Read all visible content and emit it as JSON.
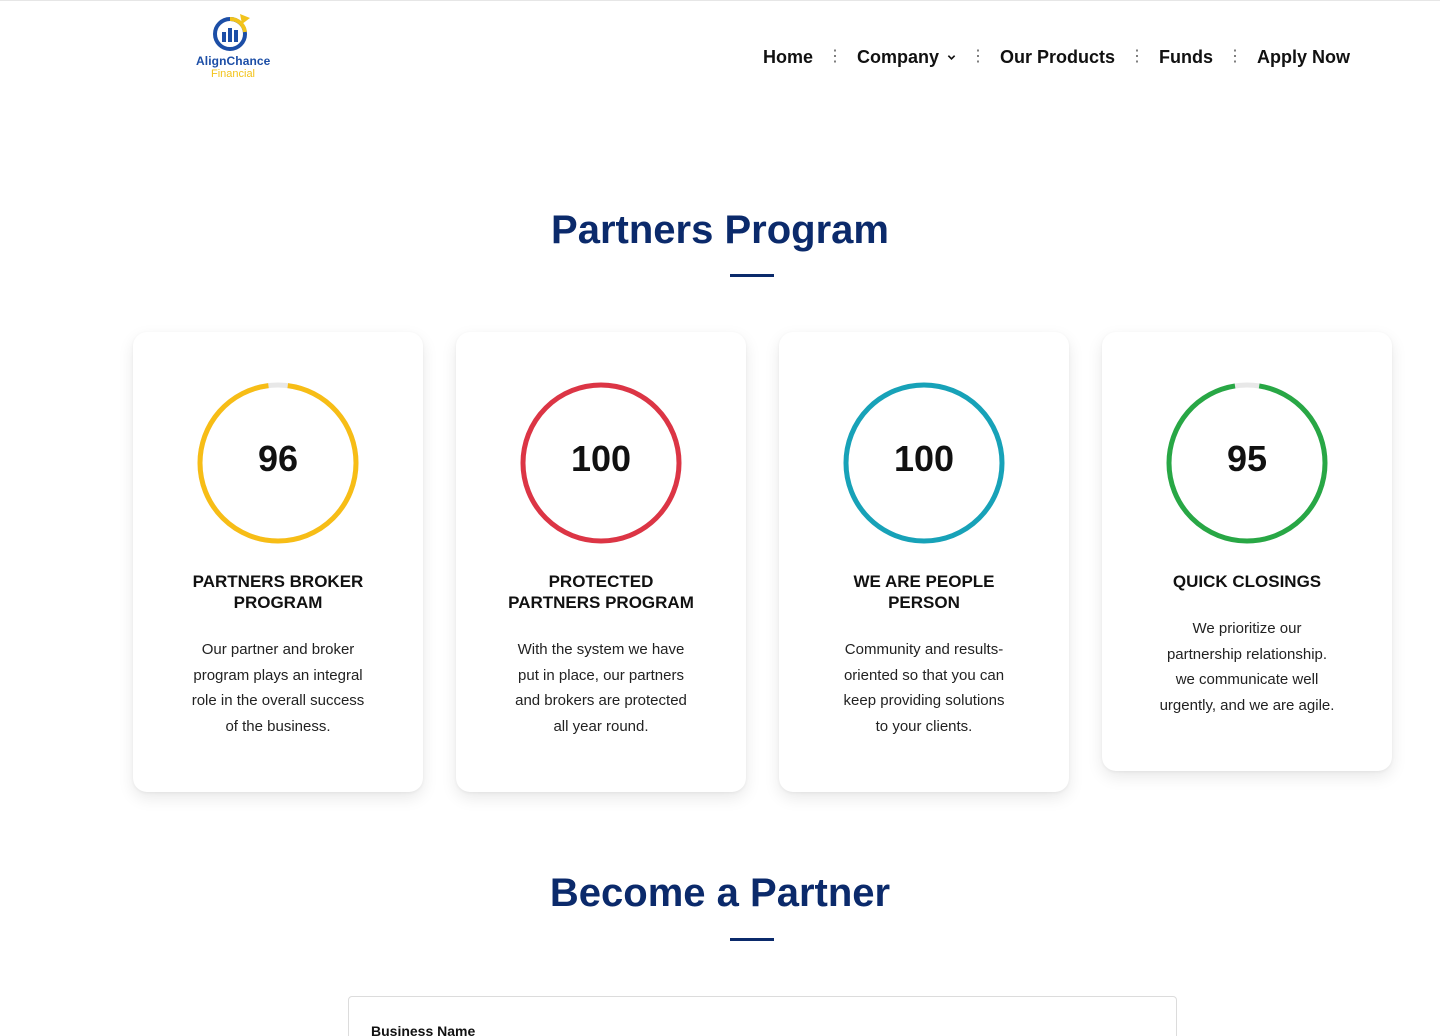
{
  "brand": {
    "name": "AlignChance",
    "sub": "Financial",
    "colors": {
      "blue": "#1c4ea6",
      "gold": "#f2c31b"
    }
  },
  "nav": {
    "items": [
      {
        "label": "Home"
      },
      {
        "label": "Company",
        "dropdown": true
      },
      {
        "label": "Our Products"
      },
      {
        "label": "Funds"
      },
      {
        "label": "Apply Now"
      }
    ]
  },
  "partners": {
    "title": "Partners Program",
    "cards": [
      {
        "value": "96",
        "percent": 96,
        "color": "#f7bd16",
        "title": "PARTNERS BROKER PROGRAM",
        "title_lines": [
          "PARTNERS BROKER",
          "PROGRAM"
        ],
        "text_lines": [
          "Our partner and broker",
          "program plays an integral",
          "role in the overall success",
          "of the business."
        ]
      },
      {
        "value": "100",
        "percent": 100,
        "color": "#dc3545",
        "title": "PROTECTED PARTNERS PROGRAM",
        "title_lines": [
          "PROTECTED",
          "PARTNERS PROGRAM"
        ],
        "text_lines": [
          "With the system we have",
          "put in place, our partners",
          "and brokers are protected",
          "all year round."
        ]
      },
      {
        "value": "100",
        "percent": 100,
        "color": "#17a2b8",
        "title": "WE ARE PEOPLE PERSON",
        "title_lines": [
          "WE ARE PEOPLE",
          "PERSON"
        ],
        "text_lines": [
          "Community and results-",
          "oriented so that you can",
          "keep providing solutions",
          "to your clients."
        ]
      },
      {
        "value": "95",
        "percent": 95,
        "color": "#28a745",
        "title": "QUICK CLOSINGS",
        "title_lines": [
          "QUICK CLOSINGS"
        ],
        "text_lines": [
          "We prioritize our",
          "partnership relationship.",
          "we communicate well",
          "urgently, and we are agile."
        ]
      }
    ]
  },
  "become": {
    "title": "Become a Partner",
    "form": {
      "business_name_label": "Business Name"
    }
  },
  "colors": {
    "heading": "#0b2a6b",
    "track": "#e8e8e8"
  }
}
